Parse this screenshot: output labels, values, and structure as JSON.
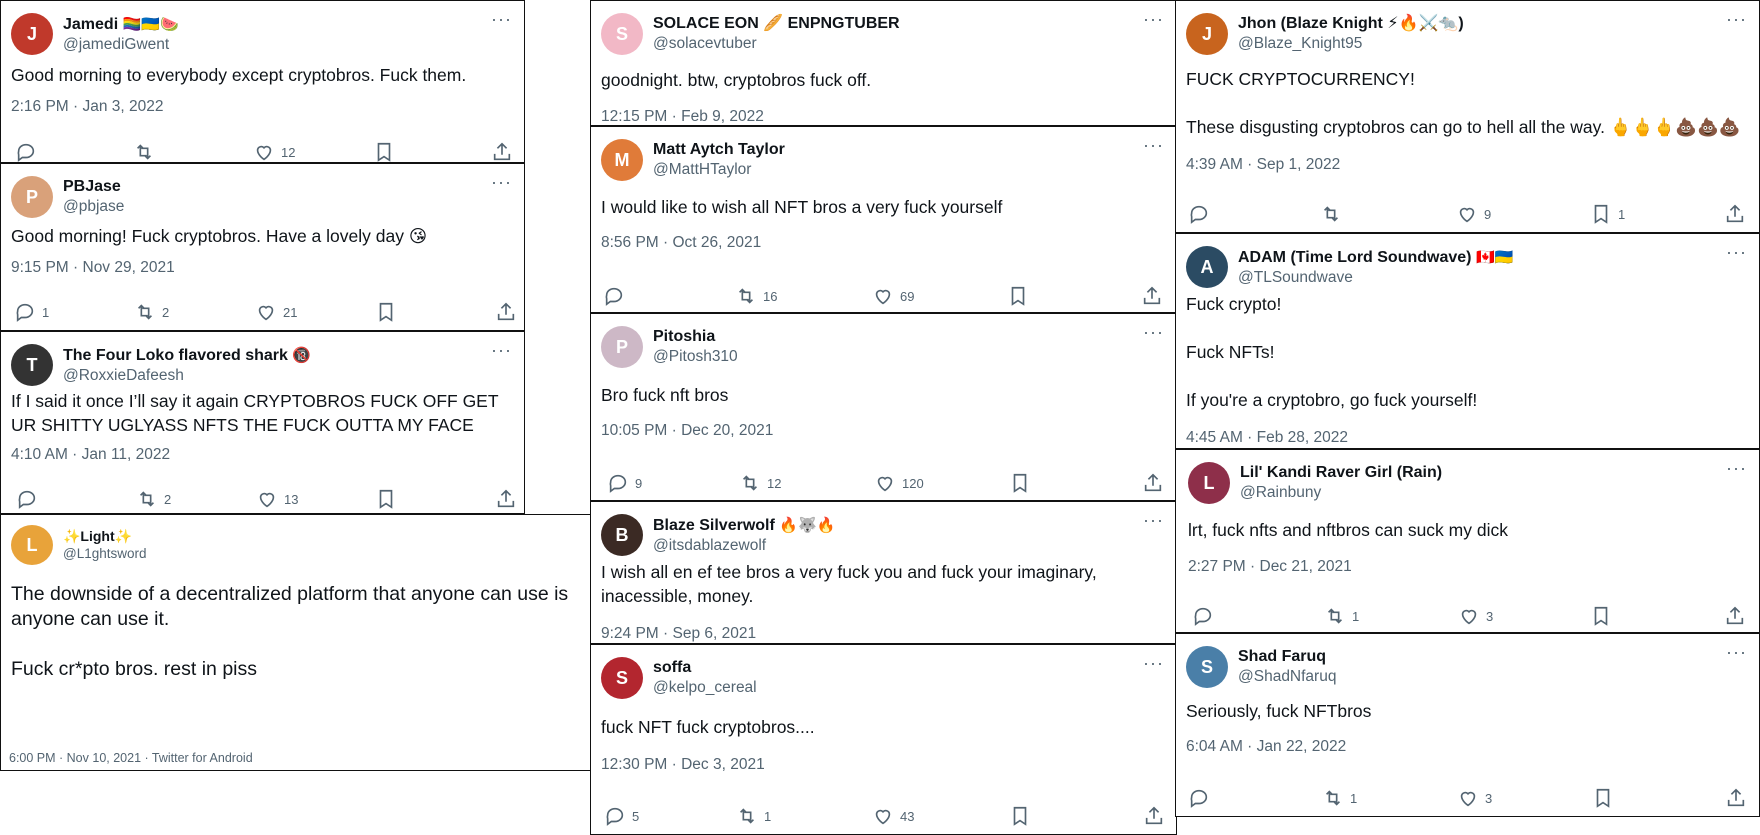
{
  "colors": {
    "text": "#0f1419",
    "secondary": "#536471",
    "border": "#111111"
  },
  "tweets": [
    {
      "display_name": "Jamedi",
      "badges": "🏳️‍🌈🇺🇦🍉",
      "handle": "@jamediGwent",
      "text": "Good morning to everybody except cryptobros. Fuck them.",
      "meta": "2:16 PM · Jan 3, 2022",
      "replies": "",
      "retweets": "",
      "likes": "12",
      "bookmarks": ""
    },
    {
      "display_name": "PBJase",
      "badges": "",
      "handle": "@pbjase",
      "text": "Good morning! Fuck cryptobros. Have a lovely day 😘",
      "meta": "9:15 PM · Nov 29, 2021",
      "replies": "1",
      "retweets": "2",
      "likes": "21",
      "bookmarks": ""
    },
    {
      "display_name": "The Four Loko flavored shark",
      "badges": "🔞",
      "handle": "@RoxxieDafeesh",
      "text": "If I said it once I’ll say it again CRYPTOBROS FUCK OFF GET UR SHITTY UGLYASS NFTS THE FUCK OUTTA MY FACE",
      "meta": "4:10 AM · Jan 11, 2022",
      "replies": "",
      "retweets": "2",
      "likes": "13",
      "bookmarks": ""
    },
    {
      "display_name": "✨Light✨",
      "badges": "",
      "handle": "@L1ghtsword",
      "text": "The downside of a decentralized platform that anyone can use is anyone can use it.\n\nFuck cr*pto bros. rest in piss",
      "meta": "6:00 PM · Nov 10, 2021 · Twitter for Android"
    },
    {
      "display_name": "SOLACE EON 🥖 ENPNGTUBER",
      "badges": "",
      "handle": "@solacevtuber",
      "text": "goodnight. btw, cryptobros fuck off.",
      "meta": "12:15 PM · Feb 9, 2022"
    },
    {
      "display_name": "Matt Aytch Taylor",
      "badges": "",
      "handle": "@MattHTaylor",
      "text": "I would like to wish all NFT bros a very fuck yourself",
      "meta": "8:56 PM · Oct 26, 2021",
      "replies": "",
      "retweets": "16",
      "likes": "69",
      "bookmarks": ""
    },
    {
      "display_name": "Pitoshia",
      "badges": "",
      "handle": "@Pitosh310",
      "text": "Bro fuck nft bros",
      "meta": "10:05 PM · Dec 20, 2021",
      "replies": "9",
      "retweets": "12",
      "likes": "120",
      "bookmarks": ""
    },
    {
      "display_name": "Blaze Silverwolf",
      "badges": "🔥🐺🔥",
      "handle": "@itsdablazewolf",
      "text": "I wish all en ef tee bros a very fuck you and fuck your imaginary, inacessible, money.",
      "meta": "9:24 PM · Sep 6, 2021"
    },
    {
      "display_name": "soffa",
      "badges": "",
      "handle": "@kelpo_cereal",
      "text": "fuck NFT fuck cryptobros....",
      "meta": "12:30 PM · Dec 3, 2021",
      "replies": "5",
      "retweets": "1",
      "likes": "43",
      "bookmarks": ""
    },
    {
      "display_name": "Jhon (Blaze Knight ⚡🔥⚔️🐀)",
      "badges": "",
      "handle": "@Blaze_Knight95",
      "text": "FUCK CRYPTOCURRENCY!\n\nThese disgusting cryptobros can go to hell all the way. 🖕🖕🖕💩💩💩",
      "meta": "4:39 AM · Sep 1, 2022",
      "replies": "",
      "retweets": "",
      "likes": "9",
      "bookmarks": "1"
    },
    {
      "display_name": "ADAM (Time Lord Soundwave)",
      "badges": "🇨🇦🇺🇦",
      "handle": "@TLSoundwave",
      "text": "Fuck crypto!\n\nFuck NFTs!\n\nIf you're a cryptobro, go fuck yourself!",
      "meta": "4:45 AM · Feb 28, 2022"
    },
    {
      "display_name": "Lil' Kandi Raver Girl (Rain)",
      "badges": "",
      "handle": "@Rainbuny",
      "text": "lrt, fuck nfts and nftbros can suck my dick",
      "meta": "2:27 PM · Dec 21, 2021",
      "replies": "",
      "retweets": "1",
      "likes": "3",
      "bookmarks": ""
    },
    {
      "display_name": "Shad Faruq",
      "badges": "",
      "handle": "@ShadNfaruq",
      "text": "Seriously, fuck NFTbros",
      "meta": "6:04 AM · Jan 22, 2022",
      "replies": "",
      "retweets": "1",
      "likes": "3",
      "bookmarks": ""
    }
  ],
  "icons": {
    "more": "more-icon",
    "reply": "reply-icon",
    "retweet": "retweet-icon",
    "like": "like-icon",
    "bookmark": "bookmark-icon",
    "share": "share-icon"
  },
  "more_glyph": "···"
}
